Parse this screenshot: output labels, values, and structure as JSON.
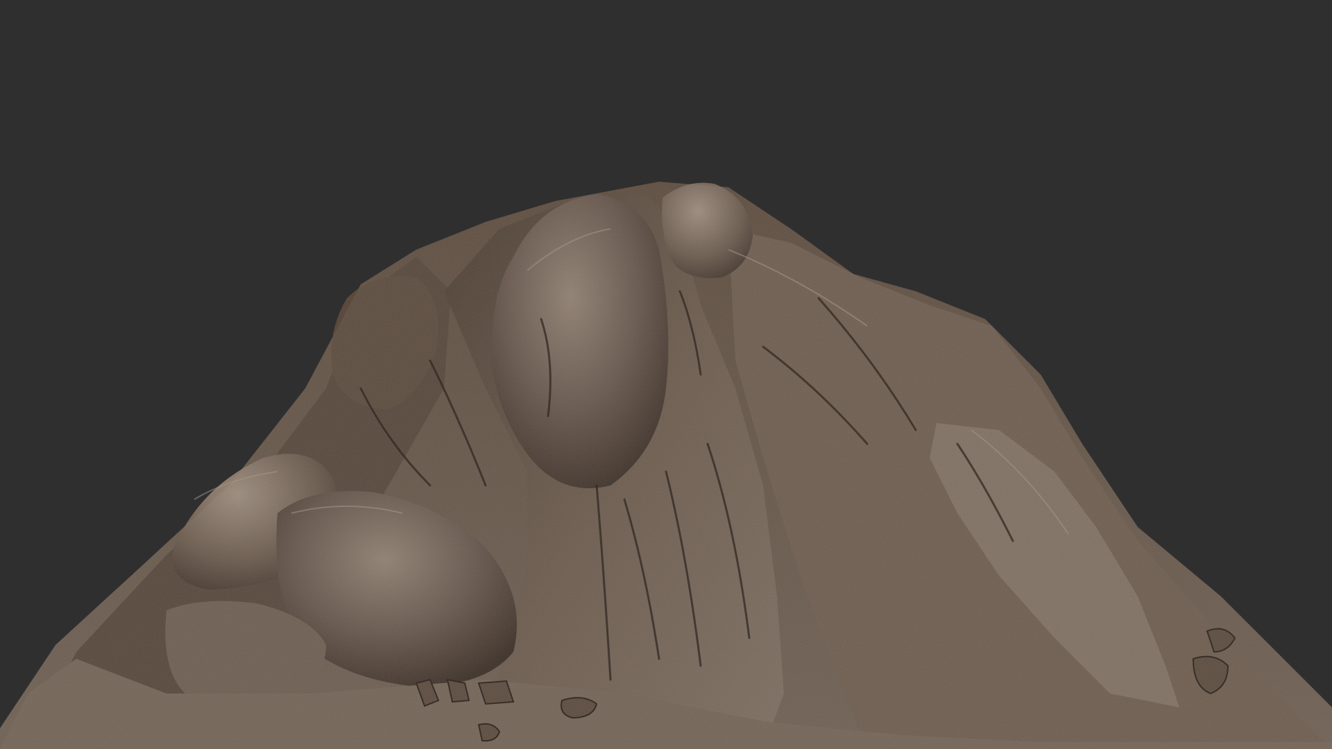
{
  "viewport": {
    "background_color": "#2f2f30"
  },
  "model": {
    "subject": "rocky-mountain-mesh",
    "colors": {
      "base": "#5a4a3c",
      "mid": "#6b5a4a",
      "light": "#8a7a6a",
      "highlight": "#a89888",
      "shadow": "#2e241c",
      "crevice": "#1f1812"
    }
  }
}
